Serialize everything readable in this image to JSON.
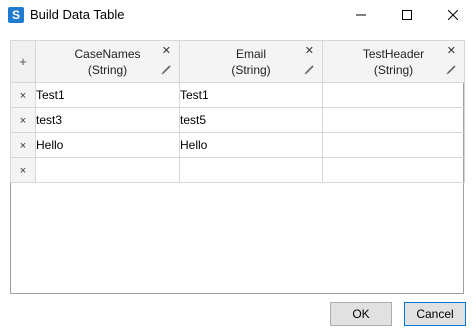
{
  "window": {
    "title": "Build Data Table",
    "app_icon_glyph": "S",
    "accent": "#1e7bd0"
  },
  "grid": {
    "add_row_glyph": "+",
    "delete_row_glyph": "×",
    "columns": [
      {
        "name": "CaseNames",
        "type": "(String)"
      },
      {
        "name": "Email",
        "type": "(String)"
      },
      {
        "name": "TestHeader",
        "type": "(String)"
      }
    ],
    "rows": [
      [
        "Test1",
        "Test1",
        ""
      ],
      [
        "test3",
        "test5",
        ""
      ],
      [
        "Hello",
        "Hello",
        ""
      ],
      [
        "",
        "",
        ""
      ]
    ]
  },
  "buttons": {
    "ok": "OK",
    "cancel": "Cancel"
  }
}
